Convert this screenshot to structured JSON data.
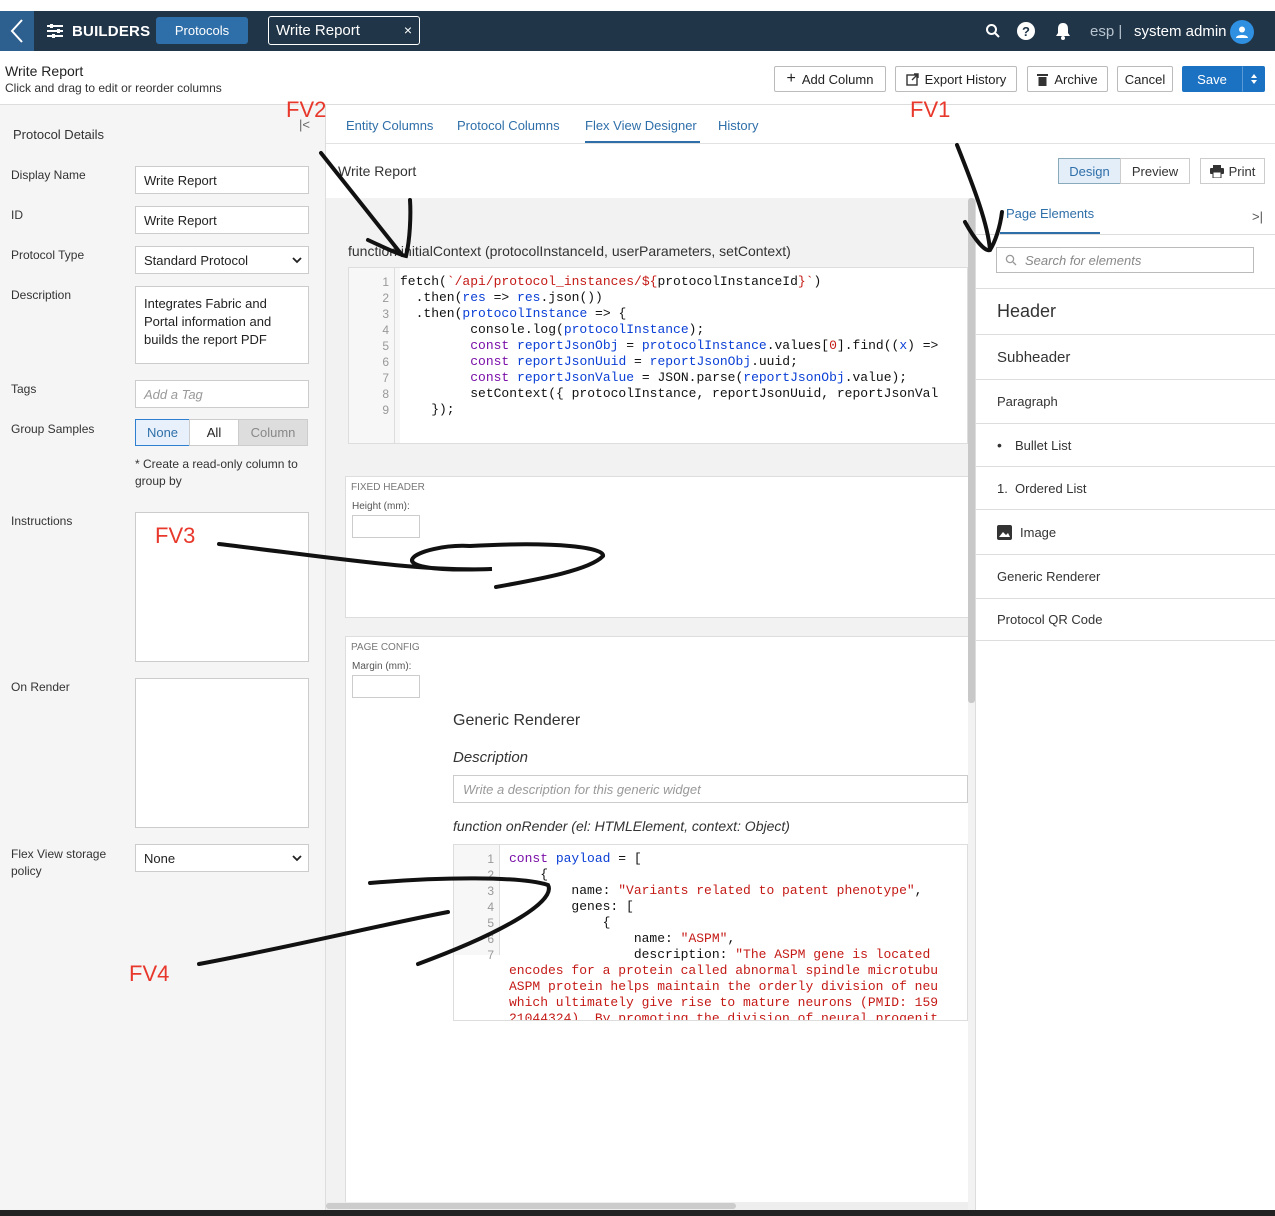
{
  "topbar": {
    "builders": "BUILDERS",
    "protocols": "Protocols",
    "tab_title": "Write Report",
    "tab_close": "×",
    "user_prefix": "esp |",
    "user_name": "system admin"
  },
  "page": {
    "title": "Write Report",
    "subtitle": "Click and drag to edit or reorder columns"
  },
  "actions": {
    "add_column": "Add Column",
    "export_history": "Export History",
    "archive": "Archive",
    "cancel": "Cancel",
    "save": "Save"
  },
  "left": {
    "section_title": "Protocol Details",
    "collapse": "|<",
    "display_name_label": "Display Name",
    "display_name": "Write Report",
    "id_label": "ID",
    "id": "Write Report",
    "protocol_type_label": "Protocol Type",
    "protocol_type": "Standard Protocol",
    "description_label": "Description",
    "description": "Integrates Fabric and Portal information and builds the report PDF",
    "tags_label": "Tags",
    "tags_placeholder": "Add a Tag",
    "group_samples_label": "Group Samples",
    "group_none": "None",
    "group_all": "All",
    "group_column": "Column",
    "group_note": "* Create a read-only column to group by",
    "instructions_label": "Instructions",
    "on_render_label": "On Render",
    "storage_label": "Flex View storage policy",
    "storage_value": "None"
  },
  "tabs": [
    "Entity Columns",
    "Protocol Columns",
    "Flex View Designer",
    "History"
  ],
  "designer": {
    "title": "Write Report",
    "design": "Design",
    "preview": "Preview",
    "print": "Print",
    "func_signature": "function initialContext (protocolInstanceId, userParameters, setContext)",
    "fixed_header_title": "FIXED HEADER",
    "fixed_header_height_label": "Height (mm):",
    "page_config_title": "PAGE CONFIG",
    "margin_label": "Margin (mm):",
    "generic_renderer_title": "Generic Renderer",
    "description_label": "Description",
    "description_placeholder": "Write a description for this generic widget",
    "on_render_signature": "function onRender (el: HTMLElement, context: Object)"
  },
  "page_elements": {
    "tab": "Page Elements",
    "collapse": ">|",
    "search_placeholder": "Search for elements",
    "items": [
      "Header",
      "Subheader",
      "Paragraph",
      "Bullet List",
      "Ordered List",
      "Image",
      "Generic Renderer",
      "Protocol QR Code"
    ]
  },
  "annotations": [
    "FV1",
    "FV2",
    "FV3",
    "FV4"
  ],
  "colors": {
    "topbar": "#203548",
    "accent": "#2f6fa9",
    "save": "#1b72c2",
    "annotation": "#e8382c"
  }
}
